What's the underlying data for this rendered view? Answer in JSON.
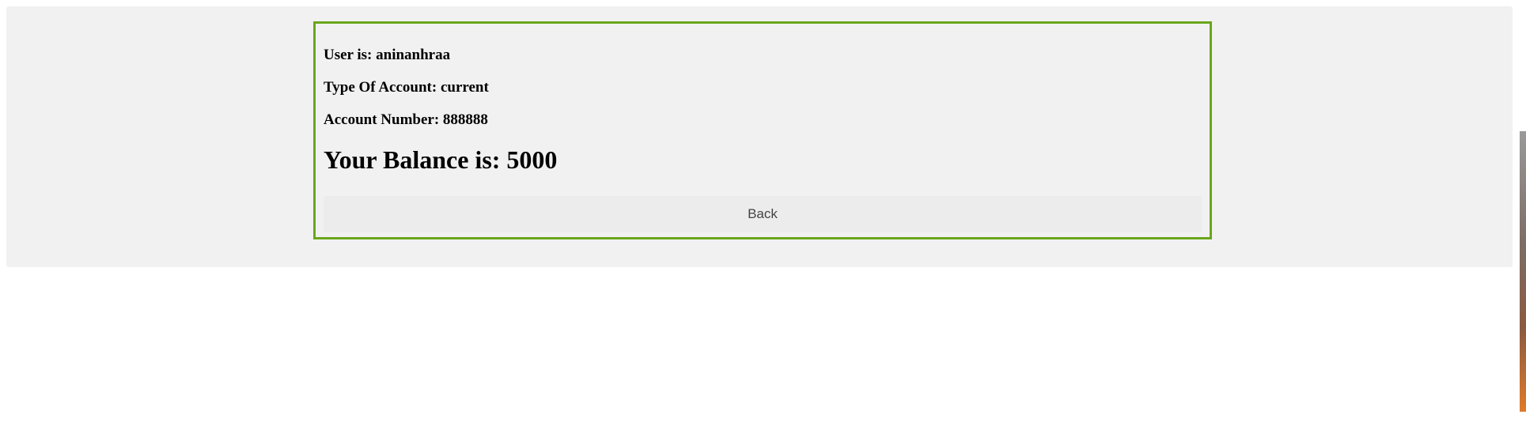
{
  "account": {
    "user_text": "User is: aninanhraa",
    "type_text": "Type Of Account: current",
    "number_text": "Account Number: 888888",
    "balance_text": "Your Balance is: 5000"
  },
  "actions": {
    "back_label": "Back"
  },
  "colors": {
    "card_border": "#6aa61b",
    "panel_background": "#f1f1f1",
    "button_background": "#ececec"
  }
}
